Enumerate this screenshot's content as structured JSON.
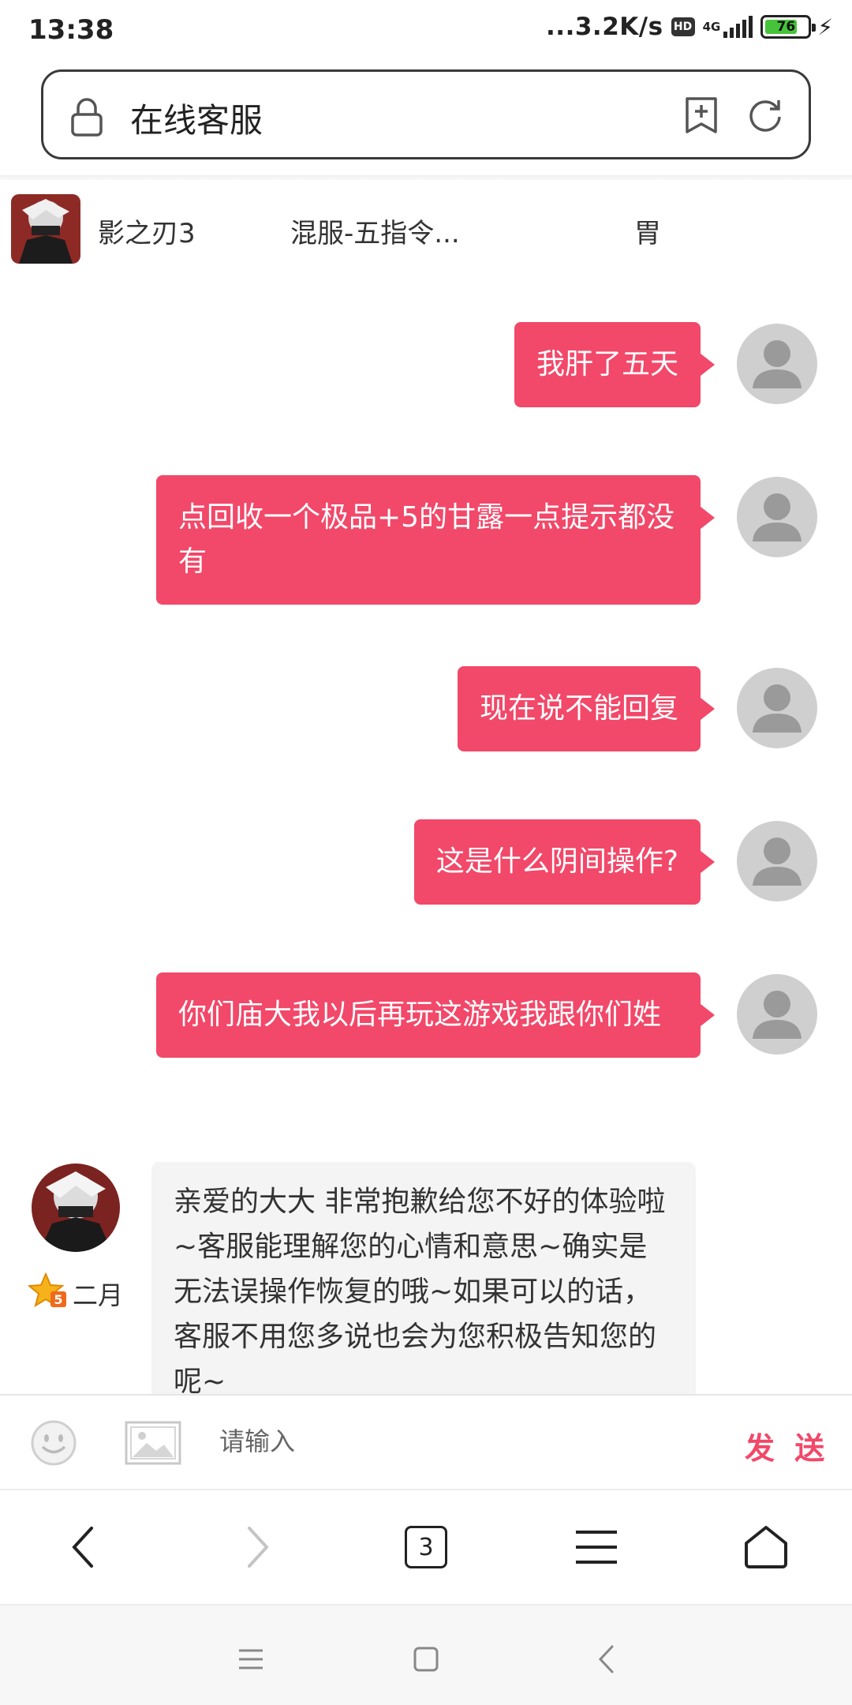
{
  "status_bar": {
    "time": "13:38",
    "network_speed": "...3.2K/s",
    "hd_badge": "HD",
    "network_type": "4G",
    "battery_level": "76",
    "battery_fraction": 0.76,
    "charging_icon": "bolt-icon"
  },
  "address_bar": {
    "title": "在线客服",
    "lock_icon": "lock-icon",
    "bookmark_icon": "add-bookmark-icon",
    "refresh_icon": "refresh-icon"
  },
  "game_bar": {
    "game_name": "影之刃3",
    "server_name": "混服-五指令...",
    "role_name": "胃"
  },
  "messages": [
    {
      "from": "user",
      "text": "我肝了五天"
    },
    {
      "from": "user",
      "text": "点回收一个极品+5的甘露一点提示都没有"
    },
    {
      "from": "user",
      "text": "现在说不能回复"
    },
    {
      "from": "user",
      "text": "这是什么阴间操作?"
    },
    {
      "from": "user",
      "text": "你们庙大我以后再玩这游戏我跟你们姓"
    },
    {
      "from": "agent",
      "name": "二月",
      "text": "亲爱的大大 非常抱歉给您不好的体验啦~客服能理解您的心情和意思~确实是无法误操作恢复的哦~如果可以的话，客服不用您多说也会为您积极告知您的呢~"
    }
  ],
  "input_bar": {
    "placeholder": "请输入",
    "send_label": "发 送",
    "emoji_icon": "emoji-icon",
    "image_icon": "image-icon"
  },
  "browser_nav": {
    "tab_count": "3",
    "back_icon": "chevron-left-icon",
    "forward_icon": "chevron-right-icon",
    "menu_icon": "menu-icon",
    "home_icon": "home-icon"
  },
  "system_nav": {
    "recents_icon": "recents-icon",
    "home_icon": "home-square-icon",
    "back_icon": "back-icon"
  },
  "colors": {
    "accent": "#f24869",
    "user_bubble": "#f24869",
    "agent_bubble": "#f4f4f5",
    "battery_fill": "#46c33b"
  }
}
